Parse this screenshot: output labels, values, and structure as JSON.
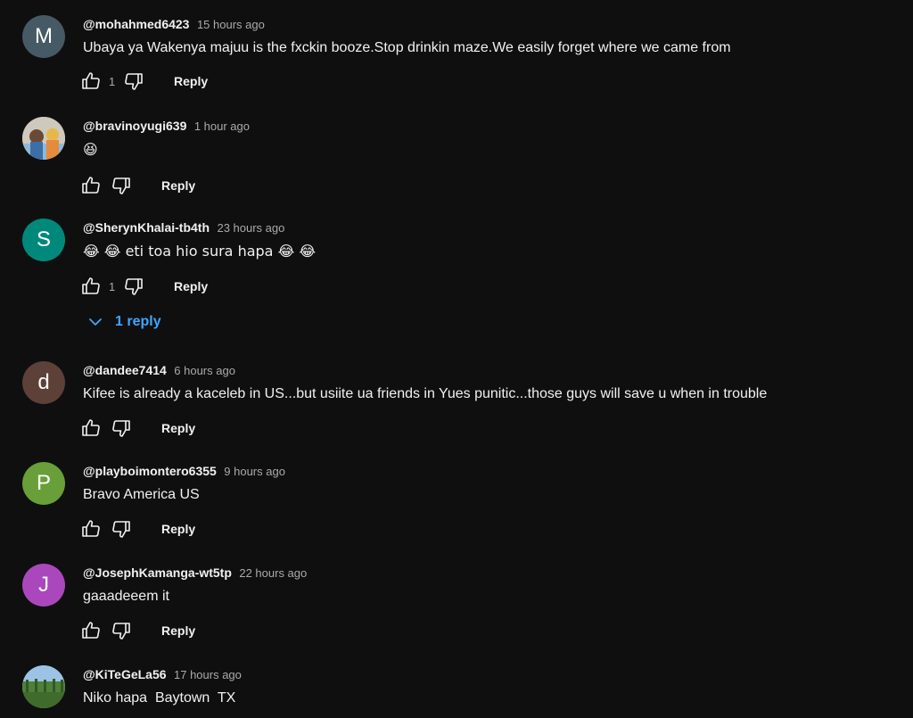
{
  "comments": [
    {
      "author": "@mohahmed6423",
      "time": "15 hours ago",
      "text": "Ubaya ya Wakenya majuu is the fxckin booze.Stop drinkin maze.We easily forget where we came from",
      "likes": "1",
      "reply_label": "Reply",
      "avatar_letter": "M",
      "avatar_color": "#455a64"
    },
    {
      "author": "@bravinoyugi639",
      "time": "1 hour ago",
      "text": "😆",
      "likes": "",
      "reply_label": "Reply",
      "avatar_letter": "",
      "avatar_color": "#c9c2b8"
    },
    {
      "author": "@SherynKhalai-tb4th",
      "time": "23 hours ago",
      "text": "😂 😂  eti toa hio sura hapa  😂 😂",
      "likes": "1",
      "reply_label": "Reply",
      "replies_label": "1 reply",
      "avatar_letter": "S",
      "avatar_color": "#00897b"
    },
    {
      "author": "@dandee7414",
      "time": "6 hours ago",
      "text": "Kifee is already a kaceleb in US...but usiite ua friends in Yues punitic...those guys will save u when in trouble",
      "likes": "",
      "reply_label": "Reply",
      "avatar_letter": "d",
      "avatar_color": "#5d4037"
    },
    {
      "author": "@playboimontero6355",
      "time": "9 hours ago",
      "text": "Bravo America US",
      "likes": "",
      "reply_label": "Reply",
      "avatar_letter": "P",
      "avatar_color": "#689f38"
    },
    {
      "author": "@JosephKamanga-wt5tp",
      "time": "22 hours ago",
      "text": "gaaadeeem it",
      "likes": "",
      "reply_label": "Reply",
      "avatar_letter": "J",
      "avatar_color": "#ab47bc"
    },
    {
      "author": "@KiTeGeLa56",
      "time": "17 hours ago",
      "text": "Niko hapa  Baytown  TX",
      "likes": "",
      "reply_label": "Reply",
      "avatar_letter": "",
      "avatar_color": "#5f8f4a"
    }
  ],
  "icons": {
    "like": "thumb-up-icon",
    "dislike": "thumb-down-icon",
    "expand": "chevron-down-icon"
  },
  "colors": {
    "background": "#0f0f0f",
    "link": "#3ea6ff",
    "secondary_text": "#aaaaaa"
  }
}
